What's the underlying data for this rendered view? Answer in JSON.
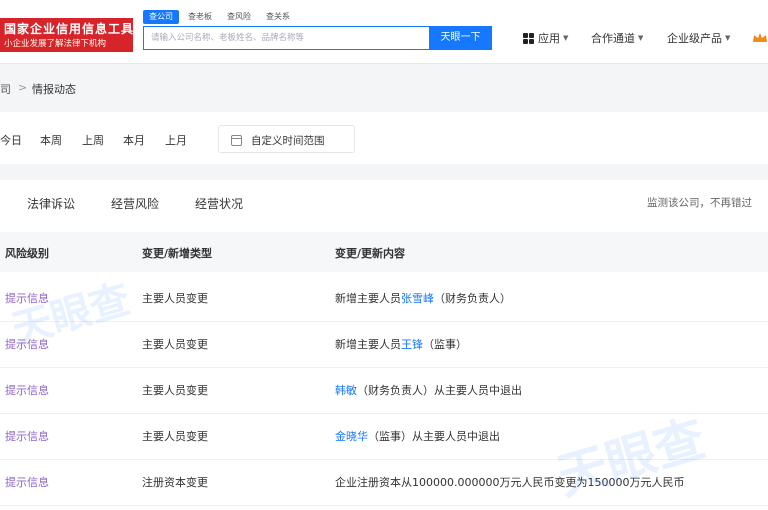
{
  "header": {
    "logo_line1": "国家企业信用信息工具",
    "logo_line2": "小企业发展了解法律下机构",
    "search_tabs": [
      "查公司",
      "查老板",
      "查风险",
      "查关系"
    ],
    "search_placeholder": "请输入公司名称、老板姓名、品牌名称等",
    "search_button": "天眼一下",
    "nav": {
      "apps": "应用",
      "cooperation": "合作通道",
      "enterprise_products": "企业级产品"
    }
  },
  "breadcrumb": {
    "parent": "司",
    "separator": ">",
    "current": "情报动态"
  },
  "time_filters": [
    "今日",
    "本周",
    "上周",
    "本月",
    "上月"
  ],
  "custom_range_label": "自定义时间范围",
  "category_tabs": [
    "法律诉讼",
    "经营风险",
    "经营状况"
  ],
  "right_note": "监测该公司，不再错过",
  "table": {
    "headers": [
      "风险级别",
      "变更/新增类型",
      "变更/更新内容"
    ],
    "rows": [
      {
        "risk": "提示信息",
        "type": "主要人员变更",
        "pre": "新增主要人员",
        "person": "张雪峰",
        "post": "（财务负责人）"
      },
      {
        "risk": "提示信息",
        "type": "主要人员变更",
        "pre": "新增主要人员",
        "person": "王锋",
        "post": "（监事）"
      },
      {
        "risk": "提示信息",
        "type": "主要人员变更",
        "pre": "",
        "person": "韩敏",
        "post": "（财务负责人）从主要人员中退出"
      },
      {
        "risk": "提示信息",
        "type": "主要人员变更",
        "pre": "",
        "person": "金晓华",
        "post": "（监事）从主要人员中退出"
      },
      {
        "risk": "提示信息",
        "type": "注册资本变更",
        "pre": "企业注册资本从100000.000000万元人民币变更为150000万元人民币",
        "person": "",
        "post": ""
      }
    ]
  },
  "watermark": "天眼查",
  "colors": {
    "brand_red": "#d6242a",
    "accent_blue": "#1677ff",
    "risk_purple": "#8d63c9"
  }
}
